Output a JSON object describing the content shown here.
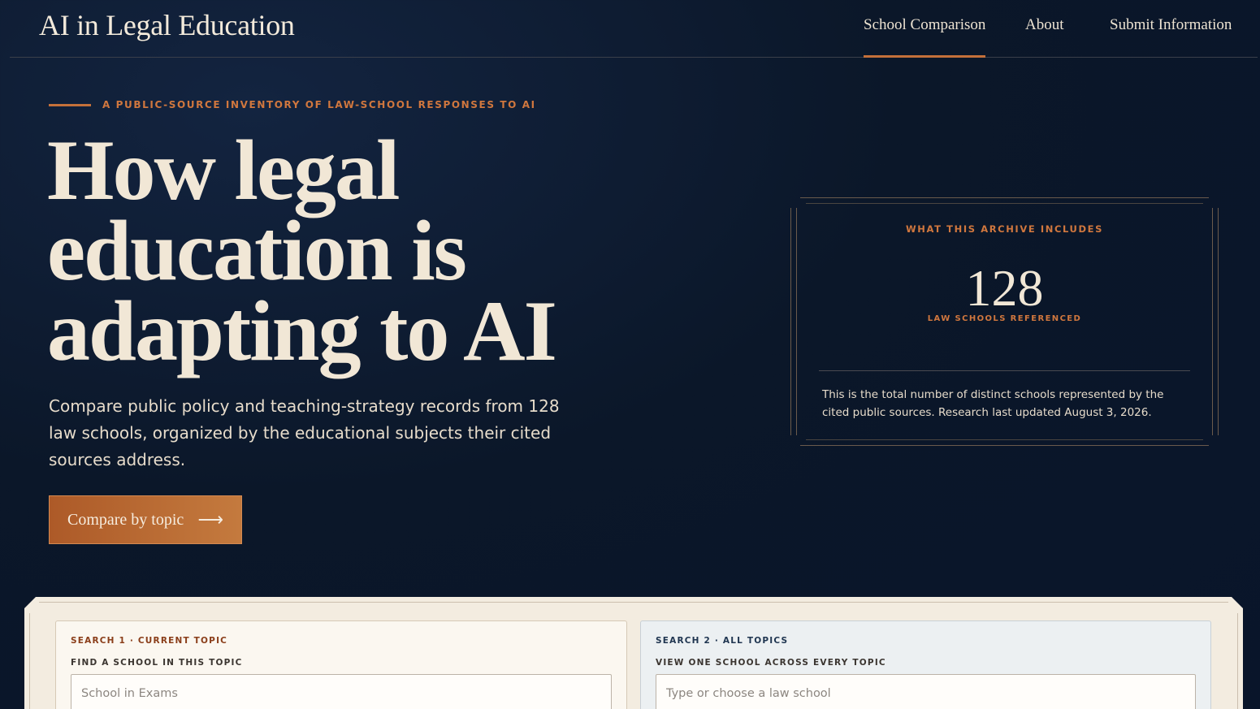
{
  "header": {
    "brand": "AI in Legal Education",
    "nav": [
      {
        "label": "School Comparison",
        "active": true
      },
      {
        "label": "About",
        "active": false
      },
      {
        "label": "Submit Information",
        "active": false
      }
    ]
  },
  "hero": {
    "eyebrow": "A PUBLIC-SOURCE INVENTORY OF LAW-SCHOOL RESPONSES TO AI",
    "title_lines": [
      "How legal",
      "education is",
      "adapting to AI"
    ],
    "subtitle": "Compare public policy and teaching-strategy records from 128 law schools, organized by the educational subjects their cited sources address.",
    "cta_label": "Compare by topic",
    "cta_arrow": "⟶"
  },
  "stat_card": {
    "label": "WHAT THIS ARCHIVE INCLUDES",
    "number": "128",
    "caption": "LAW SCHOOLS REFERENCED",
    "body": "This is the total number of distinct schools represented by the cited public sources. Research last updated August 3, 2026."
  },
  "search": {
    "one": {
      "eyebrow": "SEARCH 1 · CURRENT TOPIC",
      "label": "FIND A SCHOOL IN THIS TOPIC",
      "placeholder": "School in Exams"
    },
    "two": {
      "eyebrow": "SEARCH 2 · ALL TOPICS",
      "label": "VIEW ONE SCHOOL ACROSS EVERY TOPIC",
      "placeholder": "Type or choose a law school"
    }
  },
  "colors": {
    "background": "#0a1628",
    "accent": "#c4703a",
    "text": "#f1e7d6"
  }
}
